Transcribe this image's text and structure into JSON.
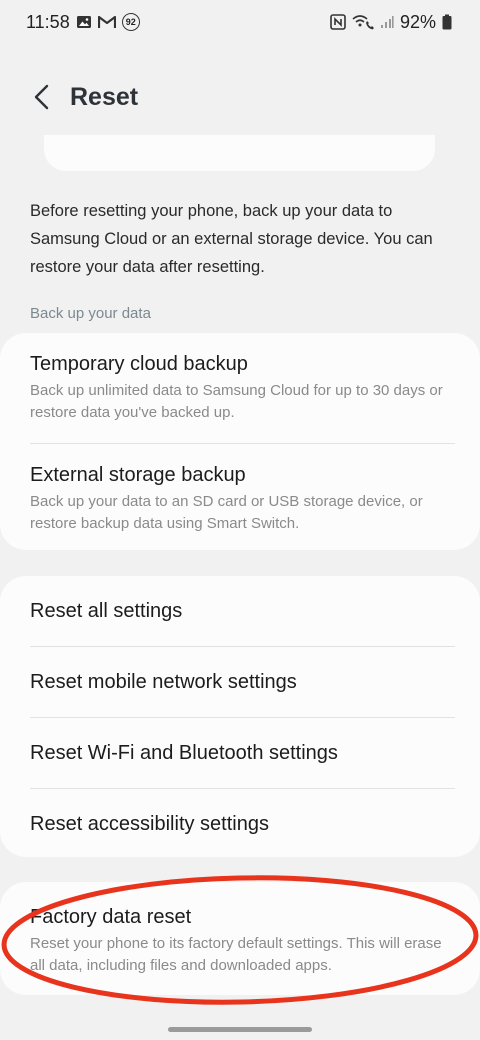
{
  "status_bar": {
    "time": "11:58",
    "notif_badge": "92",
    "battery": "92%"
  },
  "header": {
    "title": "Reset",
    "back_icon": "chevron-left-icon"
  },
  "intro_text": "Before resetting your phone, back up your data to Samsung Cloud or an external storage device. You can restore your data after resetting.",
  "backup_section": {
    "label": "Back up your data",
    "items": [
      {
        "title": "Temporary cloud backup",
        "subtitle": "Back up unlimited data to Samsung Cloud for up to 30 days or restore data you've backed up."
      },
      {
        "title": "External storage backup",
        "subtitle": "Back up your data to an SD card or USB storage device, or restore backup data using Smart Switch."
      }
    ]
  },
  "reset_section": {
    "items": [
      {
        "title": "Reset all settings"
      },
      {
        "title": "Reset mobile network settings"
      },
      {
        "title": "Reset Wi-Fi and Bluetooth settings"
      },
      {
        "title": "Reset accessibility settings"
      }
    ]
  },
  "factory_section": {
    "title": "Factory data reset",
    "subtitle": "Reset your phone to its factory default settings. This will erase all data, including files and downloaded apps."
  },
  "colors": {
    "background": "#f1f1f1",
    "card": "#fcfcfc",
    "annotation": "#e8341c",
    "section_label": "#7b8a8f"
  }
}
